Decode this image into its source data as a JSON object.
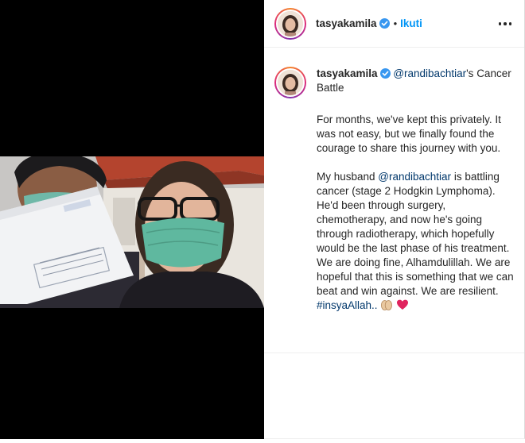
{
  "post": {
    "username": "tasyakamila",
    "follow_label": "Ikuti",
    "separator": "•",
    "verified_icon": "verified-badge-icon",
    "more_icon": "more-options-icon",
    "caption": {
      "username": "tasyakamila",
      "line1_mention": "@randibachtiar",
      "line1_suffix": "'s",
      "line1_rest": "Cancer Battle",
      "para1": "For months, we've kept this privately. It was not easy, but we finally found the courage to share this journey with you.",
      "para2_prefix": "My husband ",
      "para2_mention": "@randibachtiar",
      "para2_rest": " is battling cancer (stage 2 Hodgkin Lymphoma). He'd been through surgery, chemotherapy, and now he's going through radiotherapy, which hopefully would be the last phase of his treatment. We are doing fine, Alhamdulillah. We are hopeful that this is something that we can beat and win against. We are resilient.",
      "hashtag": "#insyaAllah..",
      "emojis": [
        "praying-hands-emoji",
        "red-heart-emoji"
      ]
    }
  },
  "colors": {
    "link": "#00376b",
    "follow": "#0095f6",
    "verified": "#3897f0",
    "text": "#262626"
  }
}
